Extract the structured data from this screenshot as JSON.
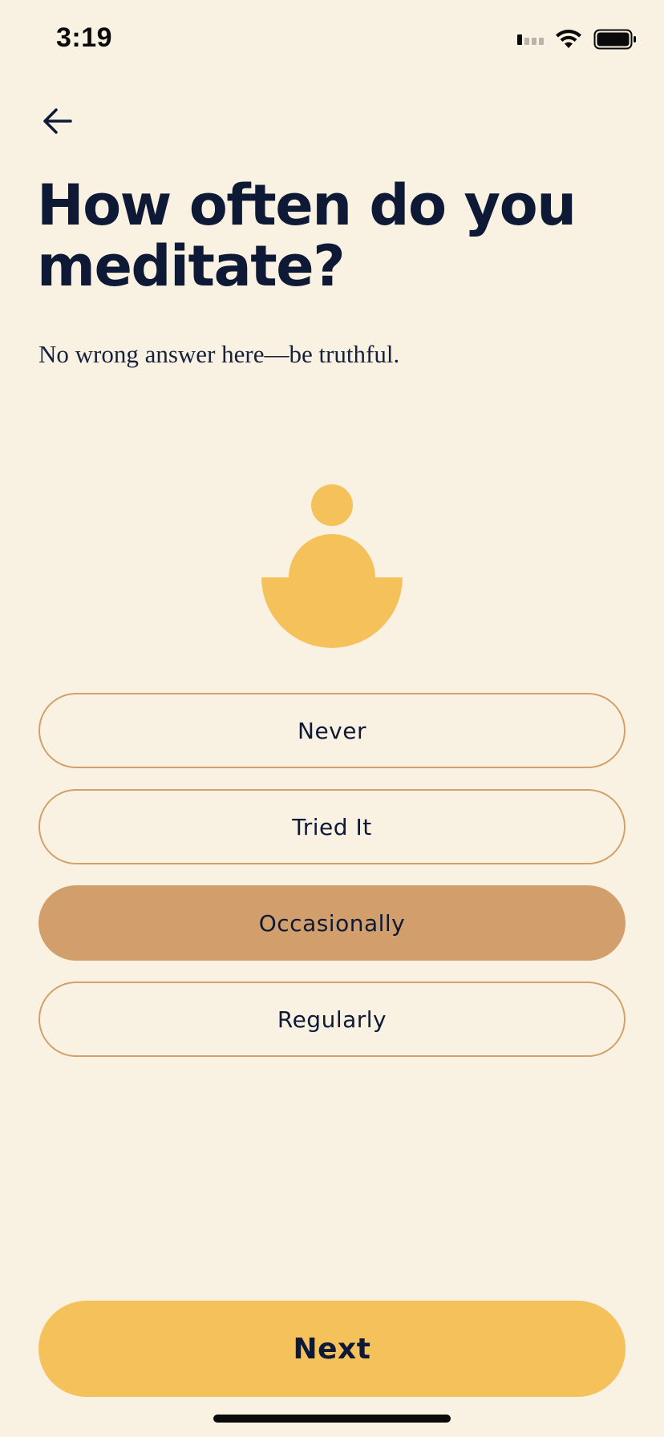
{
  "status_bar": {
    "time": "3:19",
    "icons": [
      "cellular-signal-icon",
      "wifi-icon",
      "battery-icon"
    ]
  },
  "navigation": {
    "back_icon": "arrow-left-icon"
  },
  "question": {
    "title": "How often do you meditate?",
    "subtitle": "No wrong answer here—be truthful."
  },
  "illustration": {
    "icon": "meditating-figure-icon",
    "color": "#F5C15B"
  },
  "options": [
    {
      "label": "Never",
      "selected": false
    },
    {
      "label": "Tried It",
      "selected": false
    },
    {
      "label": "Occasionally",
      "selected": true
    },
    {
      "label": "Regularly",
      "selected": false
    }
  ],
  "next_button": {
    "label": "Next"
  },
  "colors": {
    "background": "#F9F2E3",
    "text": "#0E1936",
    "option_border": "#D2A06A",
    "option_selected": "#D29E6B",
    "accent": "#F5C15B"
  }
}
